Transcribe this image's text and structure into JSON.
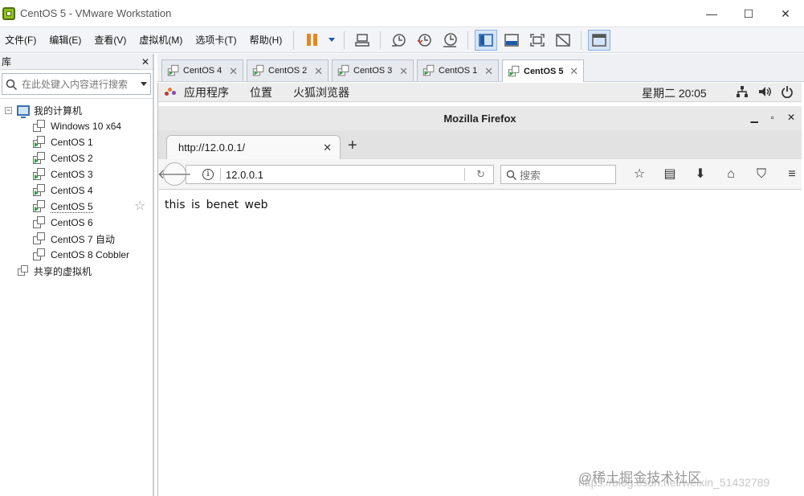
{
  "window": {
    "title": "CentOS 5 - VMware Workstation",
    "minimize": "—",
    "maximize": "☐",
    "close": "✕"
  },
  "menu": [
    "文件(F)",
    "编辑(E)",
    "查看(V)",
    "虚拟机(M)",
    "选项卡(T)",
    "帮助(H)"
  ],
  "library": {
    "title": "库",
    "close": "✕",
    "search_placeholder": "在此处键入内容进行搜索",
    "root": "我的计算机",
    "vms": [
      "Windows 10 x64",
      "CentOS 1",
      "CentOS 2",
      "CentOS 3",
      "CentOS 4",
      "CentOS 5",
      "CentOS 6",
      "CentOS 7 自动",
      "CentOS 8 Cobbler"
    ],
    "selected": "CentOS 5",
    "shared": "共享的虚拟机"
  },
  "vm_tabs": [
    {
      "label": "CentOS 4",
      "active": false
    },
    {
      "label": "CentOS 2",
      "active": false
    },
    {
      "label": "CentOS 3",
      "active": false
    },
    {
      "label": "CentOS 1",
      "active": false
    },
    {
      "label": "CentOS 5",
      "active": true
    }
  ],
  "gnome": {
    "menus": [
      "应用程序",
      "位置",
      "火狐浏览器"
    ],
    "clock": "星期二 20∶05"
  },
  "firefox": {
    "window_title": "Mozilla Firefox",
    "tab_title": "http://12.0.0.1/",
    "url": "12.0.0.1",
    "search_placeholder": "搜索",
    "page_text": "this is benet web"
  },
  "watermark": "@稀土掘金技术社区",
  "watermark_url": "https://blog.csdn.net/weixin_51432789"
}
